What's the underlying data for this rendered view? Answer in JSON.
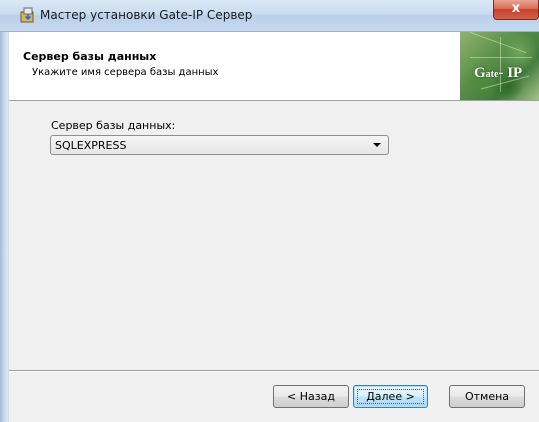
{
  "window": {
    "title": "Мастер установки Gate-IP Сервер",
    "close_label": "x"
  },
  "header": {
    "title": "Сервер базы данных",
    "subtitle": "Укажите имя сервера базы данных",
    "logo": {
      "text_main": "Gate",
      "text_initial": "G",
      "text_rest": "ate",
      "text_suffix": "- IP"
    }
  },
  "form": {
    "db_server_label": "Сервер базы данных:",
    "db_server_value": "SQLEXPRESS"
  },
  "buttons": {
    "back": "< Назад",
    "next": "Далее >",
    "cancel": "Отмена"
  },
  "colors": {
    "accent": "#3c7fb1",
    "close_red": "#c5402a"
  },
  "icons": {
    "title": "installer-icon",
    "combo": "chevron-down-icon"
  }
}
